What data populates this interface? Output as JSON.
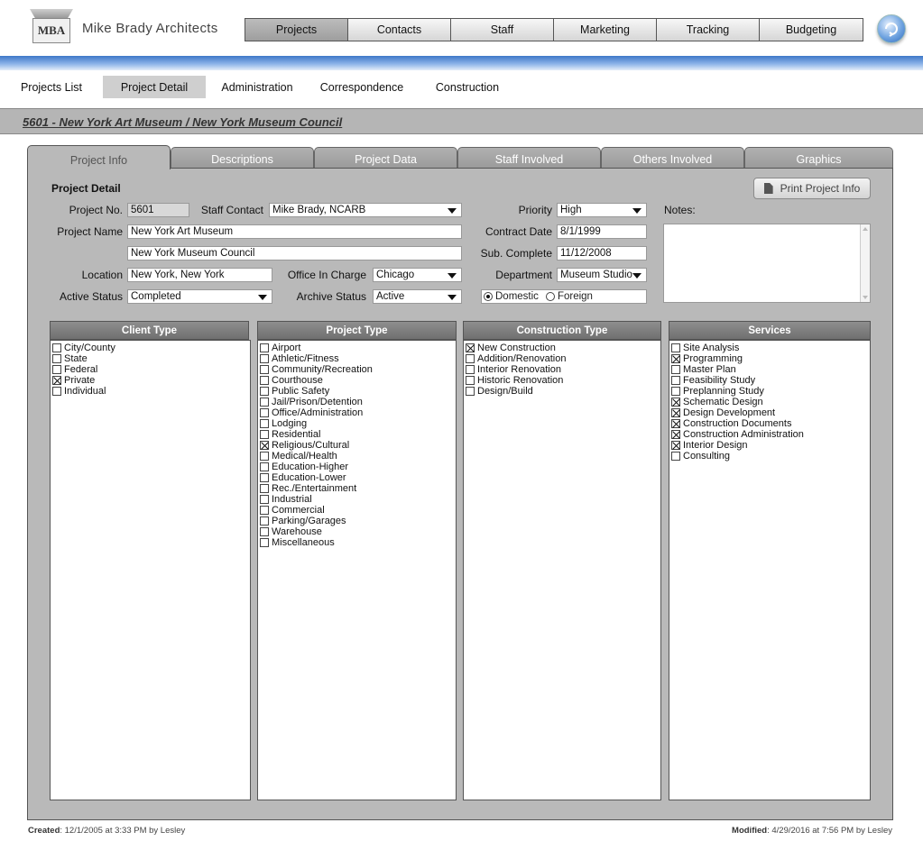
{
  "header": {
    "logo_text": "MBA",
    "firm_name": "Mike Brady Architects",
    "nav": [
      "Projects",
      "Contacts",
      "Staff",
      "Marketing",
      "Tracking",
      "Budgeting"
    ],
    "active_nav": "Projects"
  },
  "sub_nav": {
    "items": [
      "Projects List",
      "Project Detail",
      "Administration",
      "Correspondence",
      "Construction"
    ],
    "active": "Project Detail"
  },
  "title": "5601 - New York Art Museum / New York Museum Council",
  "tabs": {
    "items": [
      "Project Info",
      "Descriptions",
      "Project Data",
      "Staff Involved",
      "Others Involved",
      "Graphics"
    ],
    "active": "Project Info"
  },
  "form": {
    "section_label": "Project Detail",
    "project_no_label": "Project No.",
    "project_no": "5601",
    "staff_contact_label": "Staff Contact",
    "staff_contact": "Mike Brady, NCARB",
    "project_name_label": "Project Name",
    "project_name": "New York Art Museum",
    "project_name2": "New York Museum Council",
    "location_label": "Location",
    "location": "New York, New York",
    "office_label": "Office In Charge",
    "office": "Chicago",
    "active_status_label": "Active Status",
    "active_status": "Completed",
    "archive_status_label": "Archive Status",
    "archive_status": "Active",
    "priority_label": "Priority",
    "priority": "High",
    "contract_date_label": "Contract Date",
    "contract_date": "8/1/1999",
    "sub_complete_label": "Sub. Complete",
    "sub_complete": "11/12/2008",
    "department_label": "Department",
    "department": "Museum Studio",
    "radio_domestic": "Domestic",
    "radio_foreign": "Foreign",
    "radio_selected": "Domestic",
    "notes_label": "Notes:",
    "print_button": "Print Project Info"
  },
  "lists": {
    "client_type": {
      "title": "Client Type",
      "items": [
        {
          "label": "City/County",
          "checked": false
        },
        {
          "label": "State",
          "checked": false
        },
        {
          "label": "Federal",
          "checked": false
        },
        {
          "label": "Private",
          "checked": true
        },
        {
          "label": "Individual",
          "checked": false
        }
      ]
    },
    "project_type": {
      "title": "Project Type",
      "items": [
        {
          "label": "Airport",
          "checked": false
        },
        {
          "label": "Athletic/Fitness",
          "checked": false
        },
        {
          "label": "Community/Recreation",
          "checked": false
        },
        {
          "label": "Courthouse",
          "checked": false
        },
        {
          "label": "Public Safety",
          "checked": false
        },
        {
          "label": "Jail/Prison/Detention",
          "checked": false
        },
        {
          "label": "Office/Administration",
          "checked": false
        },
        {
          "label": "Lodging",
          "checked": false
        },
        {
          "label": "Residential",
          "checked": false
        },
        {
          "label": "Religious/Cultural",
          "checked": true
        },
        {
          "label": "Medical/Health",
          "checked": false
        },
        {
          "label": "Education-Higher",
          "checked": false
        },
        {
          "label": "Education-Lower",
          "checked": false
        },
        {
          "label": "Rec./Entertainment",
          "checked": false
        },
        {
          "label": "Industrial",
          "checked": false
        },
        {
          "label": "Commercial",
          "checked": false
        },
        {
          "label": "Parking/Garages",
          "checked": false
        },
        {
          "label": "Warehouse",
          "checked": false
        },
        {
          "label": "Miscellaneous",
          "checked": false
        }
      ]
    },
    "construction_type": {
      "title": "Construction Type",
      "items": [
        {
          "label": "New Construction",
          "checked": true
        },
        {
          "label": "Addition/Renovation",
          "checked": false
        },
        {
          "label": "Interior Renovation",
          "checked": false
        },
        {
          "label": "Historic Renovation",
          "checked": false
        },
        {
          "label": "Design/Build",
          "checked": false
        }
      ]
    },
    "services": {
      "title": "Services",
      "items": [
        {
          "label": "Site Analysis",
          "checked": false
        },
        {
          "label": "Programming",
          "checked": true
        },
        {
          "label": "Master Plan",
          "checked": false
        },
        {
          "label": "Feasibility Study",
          "checked": false
        },
        {
          "label": "Preplanning Study",
          "checked": false
        },
        {
          "label": "Schematic Design",
          "checked": true
        },
        {
          "label": "Design Development",
          "checked": true
        },
        {
          "label": "Construction Documents",
          "checked": true
        },
        {
          "label": "Construction Administration",
          "checked": true
        },
        {
          "label": "Interior Design",
          "checked": true
        },
        {
          "label": "Consulting",
          "checked": false
        }
      ]
    }
  },
  "footer": {
    "created_label": "Created",
    "created": ": 12/1/2005 at 3:33 PM by Lesley",
    "modified_label": "Modified",
    "modified": ": 4/29/2016 at 7:56 PM by Lesley"
  },
  "icons": {
    "globe": "globe-icon",
    "print": "document-icon",
    "dropdown": "chevron-down-icon"
  },
  "colors": {
    "accent_blue": "#3e78c8",
    "panel_grey": "#b9b9b9",
    "header_grey": "#707070"
  }
}
